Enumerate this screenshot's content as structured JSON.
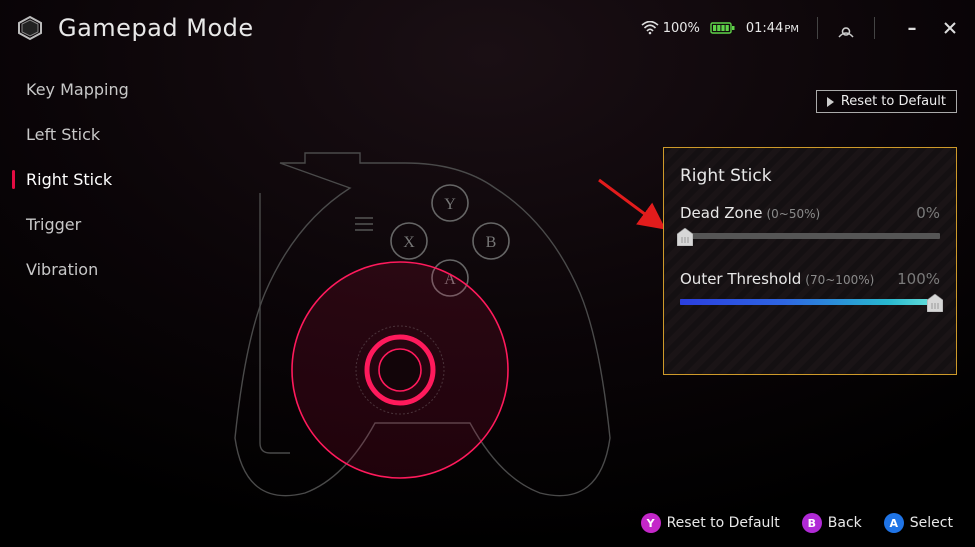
{
  "header": {
    "title": "Gamepad Mode",
    "wifi_pct": "100%",
    "clock": "01:44",
    "ampm": "PM"
  },
  "sidebar": {
    "items": [
      {
        "label": "Key Mapping",
        "active": false
      },
      {
        "label": "Left Stick",
        "active": false
      },
      {
        "label": "Right Stick",
        "active": true
      },
      {
        "label": "Trigger",
        "active": false
      },
      {
        "label": "Vibration",
        "active": false
      }
    ]
  },
  "reset_top_label": "Reset to Default",
  "card": {
    "title": "Right Stick",
    "deadzone": {
      "label": "Dead Zone",
      "range": "(0~50%)",
      "value": "0%",
      "pct": 0
    },
    "outer": {
      "label": "Outer Threshold",
      "range": "(70~100%)",
      "value": "100%",
      "pct": 100
    }
  },
  "footer": {
    "reset": "Reset to Default",
    "back": "Back",
    "select": "Select"
  },
  "gamepad_buttons": {
    "y": "Y",
    "b": "B",
    "a": "A",
    "x": "X"
  }
}
